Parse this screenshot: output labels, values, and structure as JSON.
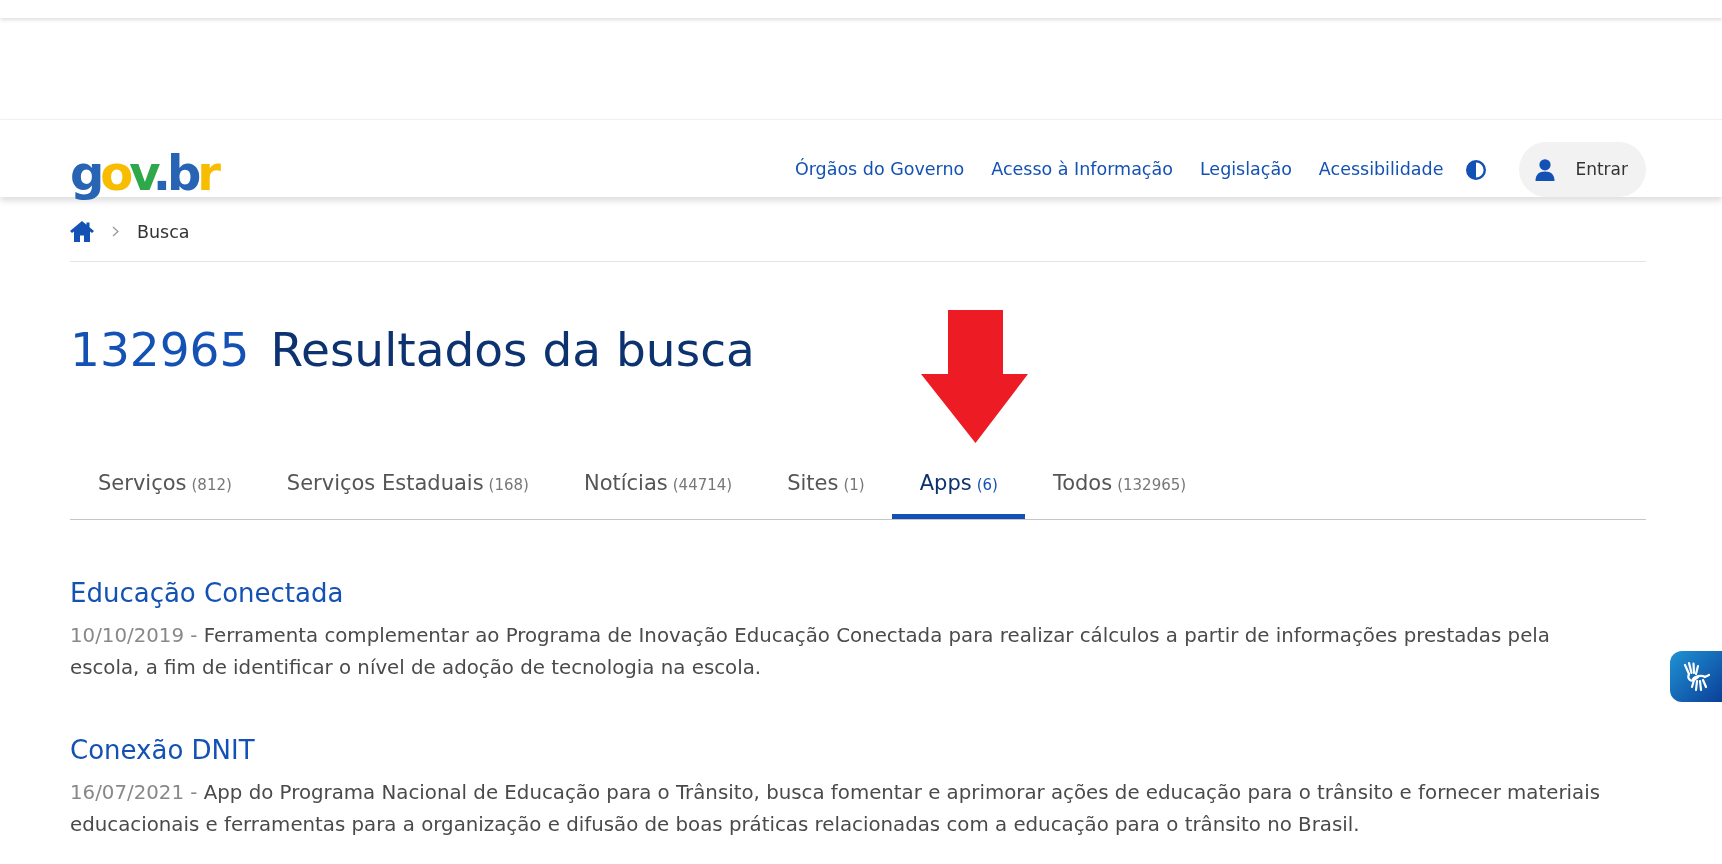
{
  "header": {
    "logo": "gov.br",
    "nav_links": [
      "Órgãos do Governo",
      "Acesso à Informação",
      "Legislação",
      "Acessibilidade"
    ],
    "login_button": "Entrar"
  },
  "breadcrumb": [
    "Busca"
  ],
  "heading": {
    "count": "132965",
    "title": "Resultados da busca"
  },
  "tabs": [
    {
      "label": "Serviços",
      "count": "(812)",
      "selected": false
    },
    {
      "label": "Serviços Estaduais",
      "count": "(168)",
      "selected": false
    },
    {
      "label": "Notícias",
      "count": "(44714)",
      "selected": false
    },
    {
      "label": "Sites",
      "count": "(1)",
      "selected": false
    },
    {
      "label": "Apps",
      "count": "(6)",
      "selected": true
    },
    {
      "label": "Todos",
      "count": "(132965)",
      "selected": false
    }
  ],
  "results": [
    {
      "title": "Educação Conectada",
      "date": "10/10/2019 -",
      "description": "Ferramenta complementar ao Programa de Inovação Educação Conectada para realizar cálculos a partir de informações prestadas pela escola, a fim de identificar o nível de adoção de tecnologia na escola."
    },
    {
      "title": "Conexão DNIT",
      "date": "16/07/2021 -",
      "description": "App do Programa Nacional de Educação para o Trânsito, busca fomentar e aprimorar ações de educação para o trânsito e fornecer materiais educacionais e ferramentas para a organização e difusão de boas práticas relacionadas com a educação para o trânsito no Brasil."
    }
  ]
}
